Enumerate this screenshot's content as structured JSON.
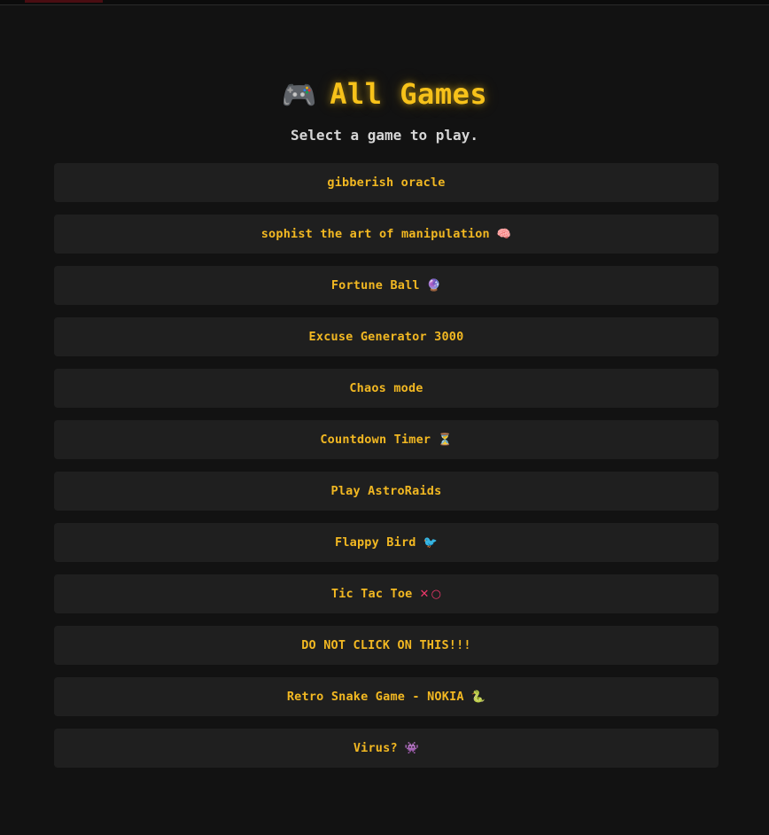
{
  "header": {
    "icon": "game-controller-icon",
    "title": "All Games",
    "subtitle": "Select a game to play."
  },
  "games": [
    {
      "label": "gibberish oracle",
      "icon": null
    },
    {
      "label": "sophist the art of manipulation",
      "icon": "brain-icon"
    },
    {
      "label": "Fortune Ball",
      "icon": "magic-ball-icon"
    },
    {
      "label": "Excuse Generator 3000",
      "icon": null
    },
    {
      "label": "Chaos mode",
      "icon": null
    },
    {
      "label": "Countdown Timer",
      "icon": "hourglass-icon"
    },
    {
      "label": "Play AstroRaids",
      "icon": null
    },
    {
      "label": "Flappy Bird",
      "icon": "bird-icon"
    },
    {
      "label": "Tic Tac Toe",
      "icon": "x-o-icon"
    },
    {
      "label": "DO NOT CLICK ON THIS!!!",
      "icon": null
    },
    {
      "label": "Retro Snake Game - NOKIA",
      "icon": "snake-icon"
    },
    {
      "label": "Virus?",
      "icon": "alien-icon"
    }
  ]
}
